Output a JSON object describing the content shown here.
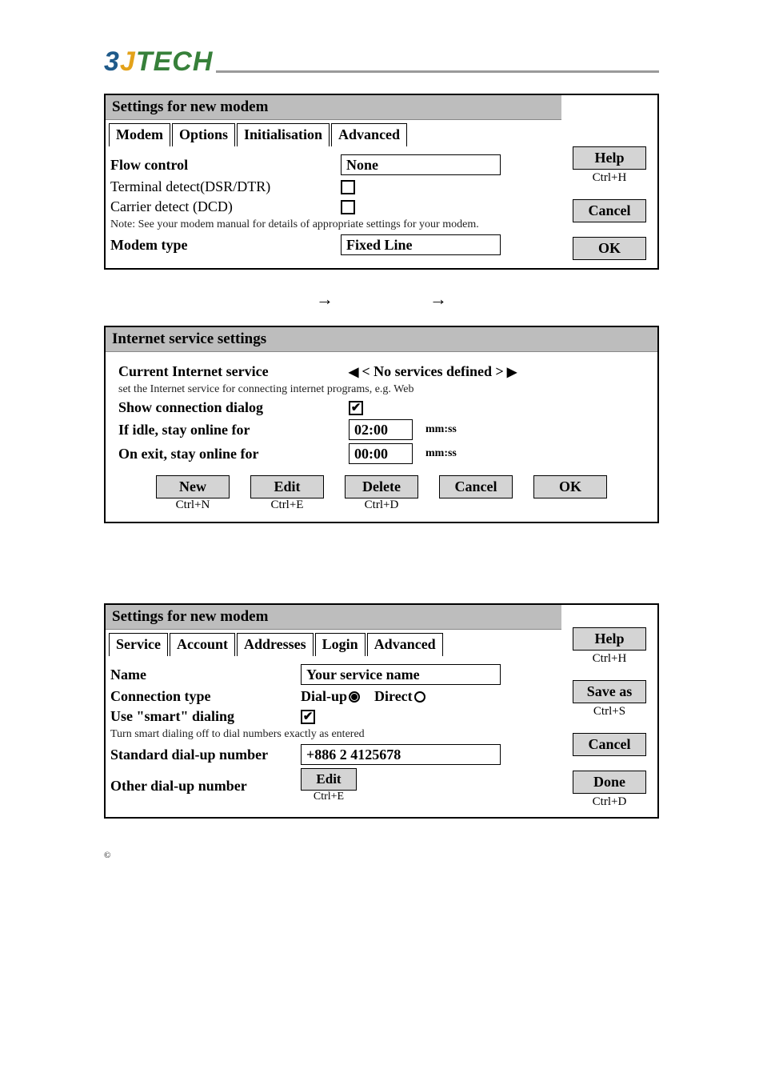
{
  "logo": {
    "p1": "3",
    "p2": "J",
    "p3": "TECH"
  },
  "panel1": {
    "title": "Settings for new modem",
    "tabs": [
      "Modem",
      "Options",
      "Initialisation",
      "Advanced"
    ],
    "flow_control_label": "Flow control",
    "flow_control_value": "None",
    "terminal_detect_label": "Terminal detect(DSR/DTR)",
    "carrier_detect_label": "Carrier detect (DCD)",
    "note": "Note: See your modem manual for details of appropriate settings for your modem.",
    "modem_type_label": "Modem type",
    "modem_type_value": "Fixed Line",
    "side": {
      "help": "Help",
      "help_sc": "Ctrl+H",
      "cancel": "Cancel",
      "ok": "OK"
    }
  },
  "arrows": {
    "a1": "→",
    "a2": "→"
  },
  "panel2": {
    "title": "Internet service settings",
    "current_label": "Current Internet service",
    "current_value": "< No services defined >",
    "current_hint": "set the Internet service for connecting internet programs, e.g. Web",
    "show_conn_label": "Show connection dialog",
    "show_conn_checked": true,
    "idle_label": "If idle, stay online for",
    "idle_value": "02:00",
    "idle_suffix": "mm:ss",
    "exit_label": "On exit, stay online for",
    "exit_value": "00:00",
    "exit_suffix": "mm:ss",
    "buttons": {
      "new": "New",
      "new_sc": "Ctrl+N",
      "edit": "Edit",
      "edit_sc": "Ctrl+E",
      "delete": "Delete",
      "delete_sc": "Ctrl+D",
      "cancel": "Cancel",
      "ok": "OK"
    }
  },
  "panel3": {
    "title": "Settings for new modem",
    "tabs": [
      "Service",
      "Account",
      "Addresses",
      "Login",
      "Advanced"
    ],
    "name_label": "Name",
    "name_value": "Your service name",
    "conn_type_label": "Connection type",
    "conn_dialup": "Dial-up",
    "conn_direct": "Direct",
    "conn_selected": "dialup",
    "smart_label": "Use \"smart\" dialing",
    "smart_checked": true,
    "smart_hint": "Turn smart dialing off to dial numbers exactly as entered",
    "std_num_label": "Standard dial-up number",
    "std_num_value": "+886 2 4125678",
    "other_num_label": "Other dial-up number",
    "other_edit": "Edit",
    "other_edit_sc": "Ctrl+E",
    "side": {
      "help": "Help",
      "help_sc": "Ctrl+H",
      "saveas": "Save as",
      "saveas_sc": "Ctrl+S",
      "cancel": "Cancel",
      "done": "Done",
      "done_sc": "Ctrl+D"
    }
  },
  "copyright": "©"
}
